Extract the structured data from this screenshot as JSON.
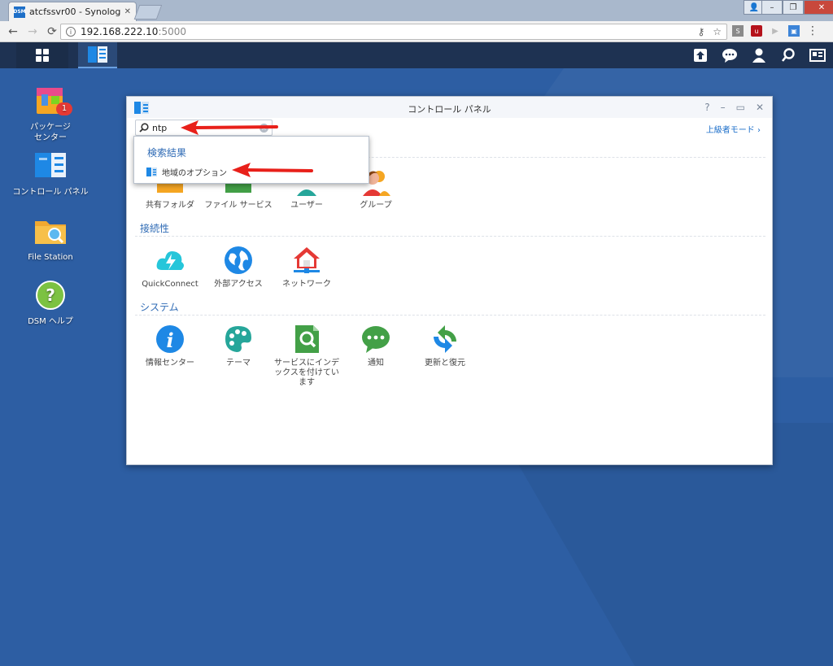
{
  "browser": {
    "tab_title": "atcfssvr00 - Synology",
    "tab_favicon": "DSM",
    "url_host": "192.168.222.10",
    "url_port": ":5000"
  },
  "desktop": {
    "icons": [
      {
        "label_line1": "パッケージ",
        "label_line2": "センター",
        "badge": "1"
      },
      {
        "label_line1": "コントロール パネル",
        "label_line2": ""
      },
      {
        "label_line1": "File Station",
        "label_line2": ""
      },
      {
        "label_line1": "DSM ヘルプ",
        "label_line2": ""
      }
    ]
  },
  "window": {
    "title": "コントロール パネル",
    "search_value": "ntp",
    "advanced_mode": "上級者モード",
    "sections": {
      "connectivity": "接続性",
      "system": "システム"
    },
    "file_sharing_items": [
      "共有フォルダ",
      "ファイル サービス",
      "ユーザー",
      "グループ"
    ],
    "connectivity_items": [
      "QuickConnect",
      "外部アクセス",
      "ネットワーク"
    ],
    "system_items": [
      "情報センター",
      "テーマ",
      "サービスにインデックスを付けています",
      "通知",
      "更新と復元"
    ]
  },
  "dropdown": {
    "header": "検索結果",
    "result": "地域のオプション"
  },
  "colors": {
    "accent": "#2f6bb5",
    "arrow": "#e8201a",
    "desktop": "#2d5ea3",
    "taskbar": "#1e3252"
  }
}
